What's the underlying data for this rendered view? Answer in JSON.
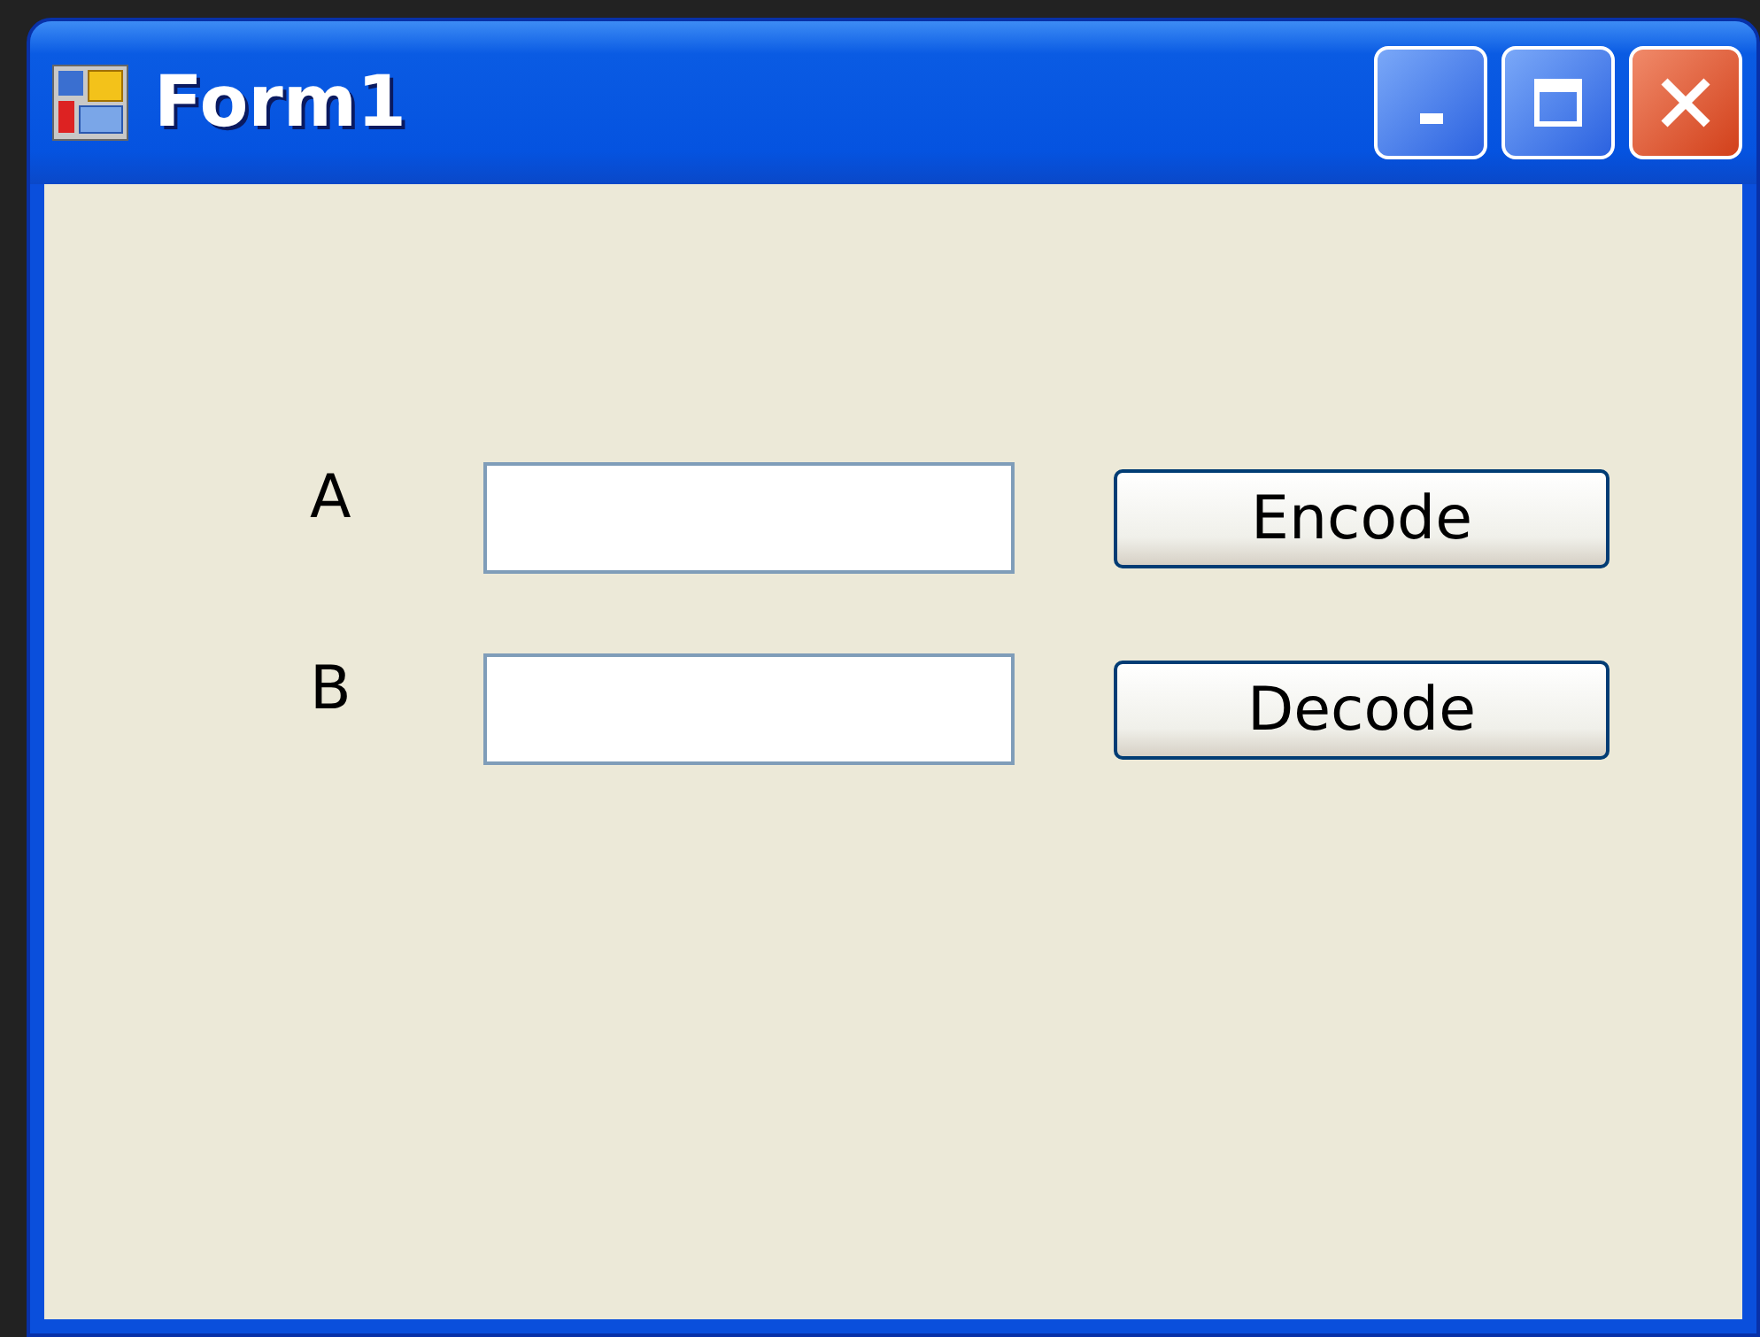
{
  "window": {
    "title": "Form1"
  },
  "rows": [
    {
      "label": "A",
      "button": "Encode"
    },
    {
      "label": "B",
      "button": "Decode"
    }
  ]
}
